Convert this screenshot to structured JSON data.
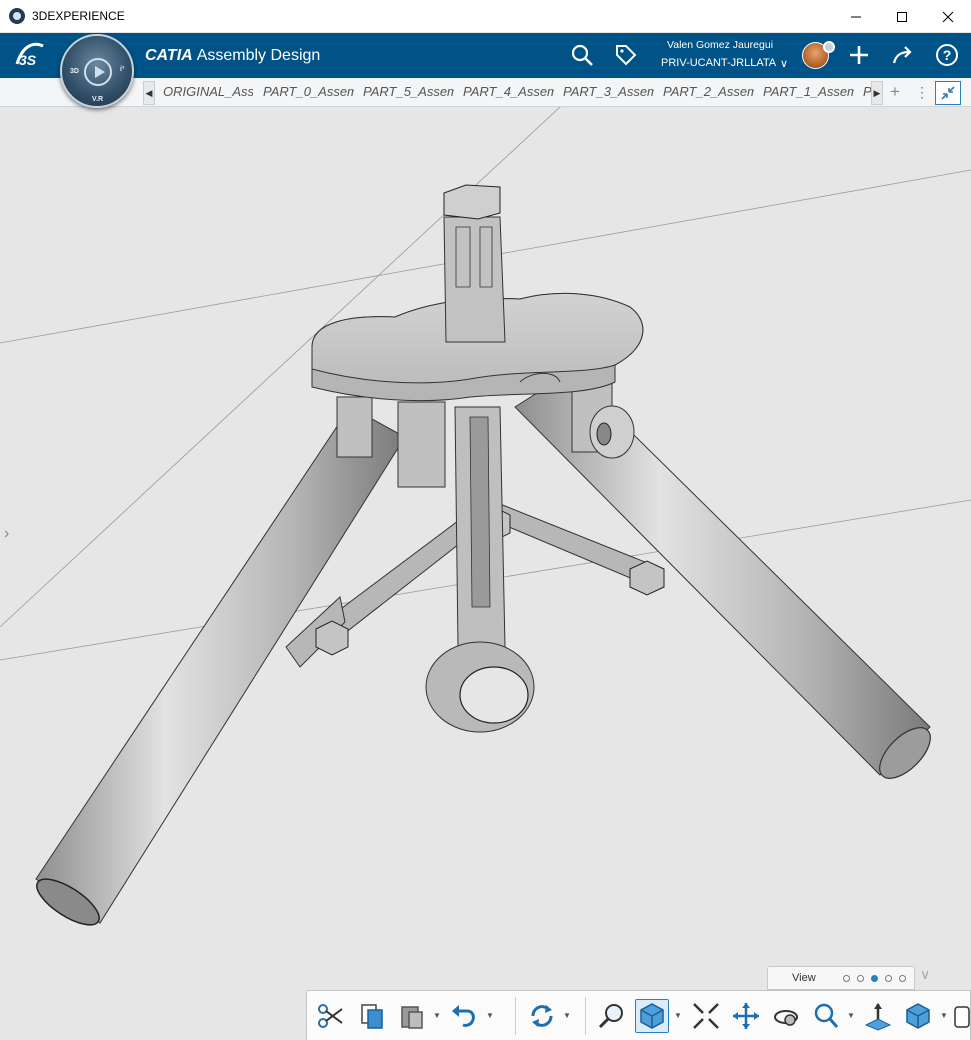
{
  "window": {
    "title": "3DEXPERIENCE",
    "controls": {
      "minimize": "minimize",
      "maximize": "maximize",
      "close": "close"
    }
  },
  "topbar": {
    "brand": "CATIA",
    "app_name": "Assembly Design",
    "compass": {
      "left": "3D",
      "right": "i³",
      "bottom": "V.R"
    },
    "user": {
      "name": "Valen Gomez Jauregui",
      "tenant": "PRIV-UCANT-JRLLATA",
      "chevron": "∨"
    },
    "icons": [
      "search-icon",
      "tag-icon",
      "add-icon",
      "share-icon",
      "help-icon"
    ]
  },
  "tabs": [
    {
      "label": "ORIGINAL_Ass"
    },
    {
      "label": "PART_0_Assem"
    },
    {
      "label": "PART_5_Assem"
    },
    {
      "label": "PART_4_Assem"
    },
    {
      "label": "PART_3_Assem"
    },
    {
      "label": "PART_2_Assem"
    },
    {
      "label": "PART_1_Assem"
    },
    {
      "label": "P"
    }
  ],
  "tabbar": {
    "plus": "+",
    "more": "⋮"
  },
  "view_panel": {
    "label": "View",
    "pages": 5,
    "active_page": 3
  },
  "actionbar": {
    "tools": [
      "cut-icon",
      "copy-icon",
      "paste-icon",
      "undo-icon",
      "update-icon",
      "zoom-area-icon",
      "view-mode-icon",
      "fit-all-icon",
      "pan-icon",
      "rotate-icon",
      "zoom-icon",
      "normal-view-icon",
      "render-style-icon",
      "more-tools-icon"
    ]
  },
  "colors": {
    "topbar": "#005386",
    "viewport": "#e6e6e6",
    "accent": "#2c7fb8",
    "part": "#b9b9b9"
  }
}
